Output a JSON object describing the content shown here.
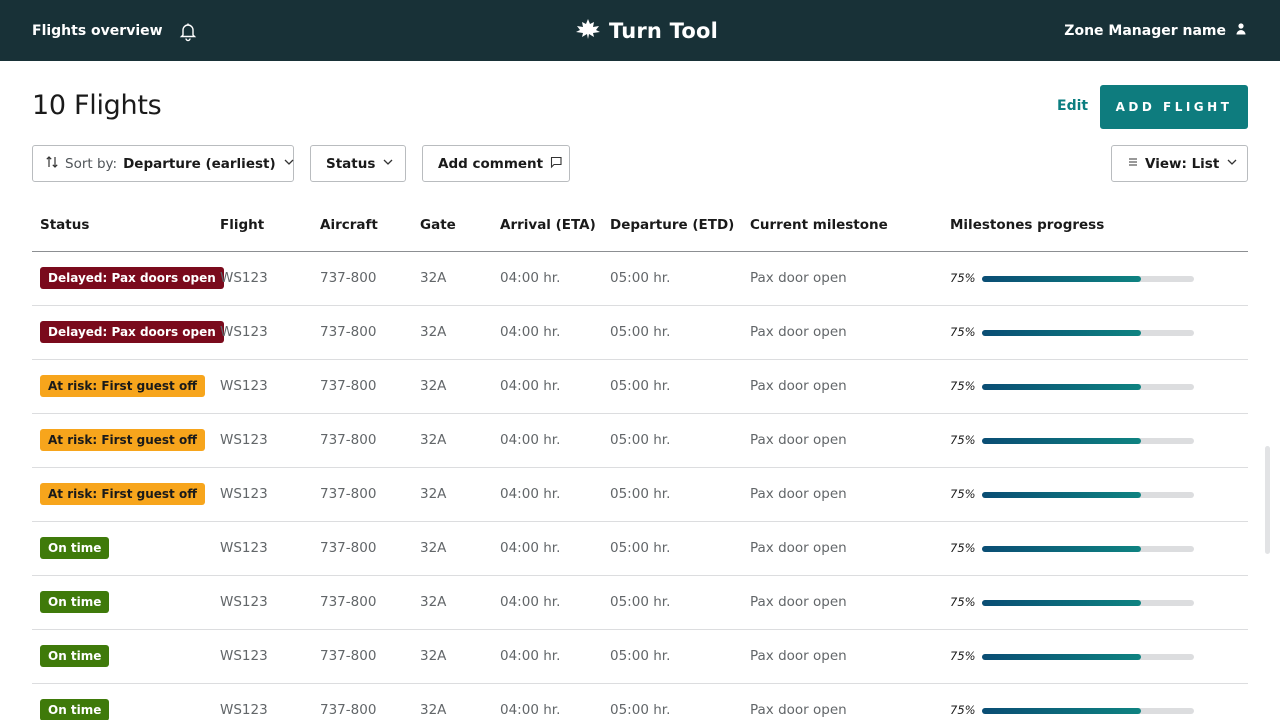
{
  "topbar": {
    "left_title": "Flights overview",
    "brand": "Turn Tool",
    "user": "Zone Manager name"
  },
  "header": {
    "title": "10 Flights",
    "edit": "Edit",
    "add_flight": "ADD FLIGHT"
  },
  "toolbar": {
    "sort_prefix": "Sort by:",
    "sort_value": "Departure (earliest)",
    "status": "Status",
    "add_comment": "Add comment",
    "view_label": "View: List"
  },
  "table": {
    "columns": [
      "Status",
      "Flight",
      "Aircraft",
      "Gate",
      "Arrival (ETA)",
      "Departure (ETD)",
      "Current milestone",
      "Milestones progress"
    ],
    "rows": [
      {
        "status": "Delayed: Pax doors open",
        "type": "delayed",
        "flight": "WS123",
        "aircraft": "737-800",
        "gate": "32A",
        "arrival": "04:00 hr.",
        "departure": "05:00 hr.",
        "milestone": "Pax door open",
        "progress_label": "75%",
        "progress": 0.75
      },
      {
        "status": "Delayed: Pax doors open",
        "type": "delayed",
        "flight": "WS123",
        "aircraft": "737-800",
        "gate": "32A",
        "arrival": "04:00 hr.",
        "departure": "05:00 hr.",
        "milestone": "Pax door open",
        "progress_label": "75%",
        "progress": 0.75
      },
      {
        "status": "At risk: First guest off",
        "type": "risk",
        "flight": "WS123",
        "aircraft": "737-800",
        "gate": "32A",
        "arrival": "04:00 hr.",
        "departure": "05:00 hr.",
        "milestone": "Pax door open",
        "progress_label": "75%",
        "progress": 0.75
      },
      {
        "status": "At risk: First guest off",
        "type": "risk",
        "flight": "WS123",
        "aircraft": "737-800",
        "gate": "32A",
        "arrival": "04:00 hr.",
        "departure": "05:00 hr.",
        "milestone": "Pax door open",
        "progress_label": "75%",
        "progress": 0.75
      },
      {
        "status": "At risk: First guest off",
        "type": "risk",
        "flight": "WS123",
        "aircraft": "737-800",
        "gate": "32A",
        "arrival": "04:00 hr.",
        "departure": "05:00 hr.",
        "milestone": "Pax door open",
        "progress_label": "75%",
        "progress": 0.75
      },
      {
        "status": "On time",
        "type": "ontime",
        "flight": "WS123",
        "aircraft": "737-800",
        "gate": "32A",
        "arrival": "04:00 hr.",
        "departure": "05:00 hr.",
        "milestone": "Pax door open",
        "progress_label": "75%",
        "progress": 0.75
      },
      {
        "status": "On time",
        "type": "ontime",
        "flight": "WS123",
        "aircraft": "737-800",
        "gate": "32A",
        "arrival": "04:00 hr.",
        "departure": "05:00 hr.",
        "milestone": "Pax door open",
        "progress_label": "75%",
        "progress": 0.75
      },
      {
        "status": "On time",
        "type": "ontime",
        "flight": "WS123",
        "aircraft": "737-800",
        "gate": "32A",
        "arrival": "04:00 hr.",
        "departure": "05:00 hr.",
        "milestone": "Pax door open",
        "progress_label": "75%",
        "progress": 0.75
      },
      {
        "status": "On time",
        "type": "ontime",
        "flight": "WS123",
        "aircraft": "737-800",
        "gate": "32A",
        "arrival": "04:00 hr.",
        "departure": "05:00 hr.",
        "milestone": "Pax door open",
        "progress_label": "75%",
        "progress": 0.75
      }
    ]
  },
  "colors": {
    "topbar_bg": "#183137",
    "accent": "#0e7c7e",
    "delayed": "#7a0a1c",
    "at_risk": "#f7a51c",
    "on_time": "#3f7a0a",
    "progress_start": "#0a4d74",
    "progress_end": "#0e8381"
  },
  "icons": {
    "bell": "bell-icon",
    "logo": "maple-leaf-logo-icon",
    "user": "user-icon",
    "sort": "sort-arrows-icon",
    "chevron": "chevron-down-icon",
    "comment": "comment-icon",
    "list": "list-icon"
  }
}
